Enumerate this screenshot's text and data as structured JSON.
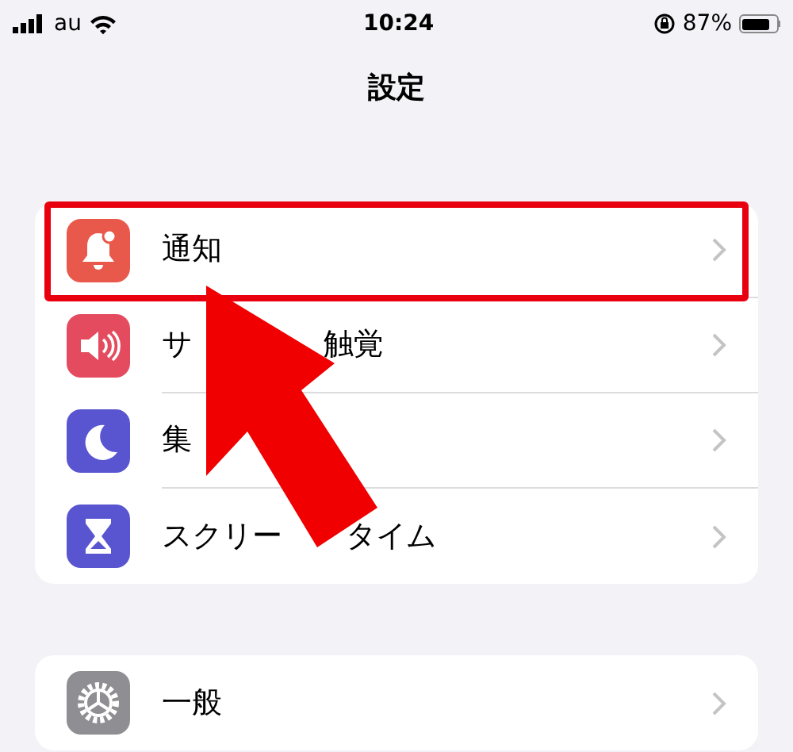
{
  "status_bar": {
    "carrier": "au",
    "time": "10:24",
    "battery_percent": "87%",
    "battery": {
      "level": 0.87
    }
  },
  "title": "設定",
  "groups": [
    {
      "rows": [
        {
          "kind": "bell",
          "color": "#e9594b",
          "label_parts": [
            "通知"
          ],
          "highlighted": true
        },
        {
          "kind": "speaker",
          "color": "#e54b5f",
          "label_parts": [
            "サ",
            "触覚"
          ],
          "highlighted": false
        },
        {
          "kind": "moon",
          "color": "#5955d1",
          "label_parts": [
            "集"
          ],
          "highlighted": false
        },
        {
          "kind": "hourglass",
          "color": "#5955d1",
          "label_parts": [
            "スクリー",
            "タイム"
          ],
          "highlighted": false
        }
      ]
    },
    {
      "rows": [
        {
          "kind": "gear",
          "color": "#8e8e93",
          "label_parts": [
            "一般"
          ],
          "highlighted": false
        }
      ]
    }
  ],
  "annotation_arrow": true
}
